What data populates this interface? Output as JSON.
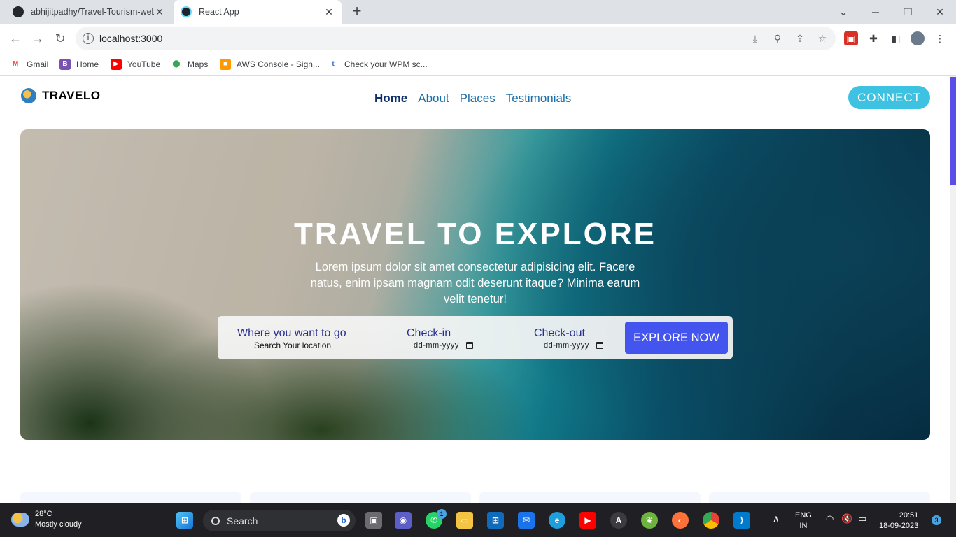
{
  "browser": {
    "tabs": [
      {
        "title": "abhijitpadhy/Travel-Tourism-web",
        "favicon": "github-icon"
      },
      {
        "title": "React App",
        "favicon": "react-icon"
      }
    ],
    "url": "localhost:3000",
    "bookmarks": [
      {
        "label": "Gmail",
        "icon": "gmail-icon",
        "color": "#ea4335"
      },
      {
        "label": "Home",
        "icon": "bootstrap-icon",
        "color": "#7952b3",
        "glyph": "B"
      },
      {
        "label": "YouTube",
        "icon": "youtube-icon",
        "color": "#ff0000"
      },
      {
        "label": "Maps",
        "icon": "maps-icon",
        "color": "#34a853"
      },
      {
        "label": "AWS Console - Sign...",
        "icon": "aws-icon",
        "color": "#ff9900"
      },
      {
        "label": "Check your WPM sc...",
        "icon": "wpm-icon",
        "color": "#2d6cdf",
        "glyph": "t"
      }
    ]
  },
  "site": {
    "logo": "TRAVELO",
    "nav": [
      "Home",
      "About",
      "Places",
      "Testimonials"
    ],
    "active_nav": "Home",
    "connect_label": "CONNECT"
  },
  "hero": {
    "title": "TRAVEL TO EXPLORE",
    "text": "Lorem ipsum dolor sit amet consectetur adipisicing elit. Facere natus, enim ipsam magnam odit deserunt itaque? Minima earum velit tenetur!"
  },
  "search": {
    "location_label": "Where you want to go",
    "location_placeholder": "Search Your location",
    "checkin_label": "Check-in",
    "checkin_value": "dd-mm-yyyy",
    "checkout_label": "Check-out",
    "checkout_value": "dd-mm-yyyy",
    "button_label": "EXPLORE NOW"
  },
  "taskbar": {
    "weather_temp": "28°C",
    "weather_desc": "Mostly cloudy",
    "search_label": "Search",
    "whatsapp_badge": "1",
    "lang_line1": "ENG",
    "lang_line2": "IN",
    "time": "20:51",
    "date": "18-09-2023",
    "notification_count": "3"
  },
  "colors": {
    "accent_connect": "#3dc2e1",
    "accent_explore": "#4355ee",
    "nav_link": "#1a6fa8",
    "nav_active": "#0d2f6e"
  }
}
